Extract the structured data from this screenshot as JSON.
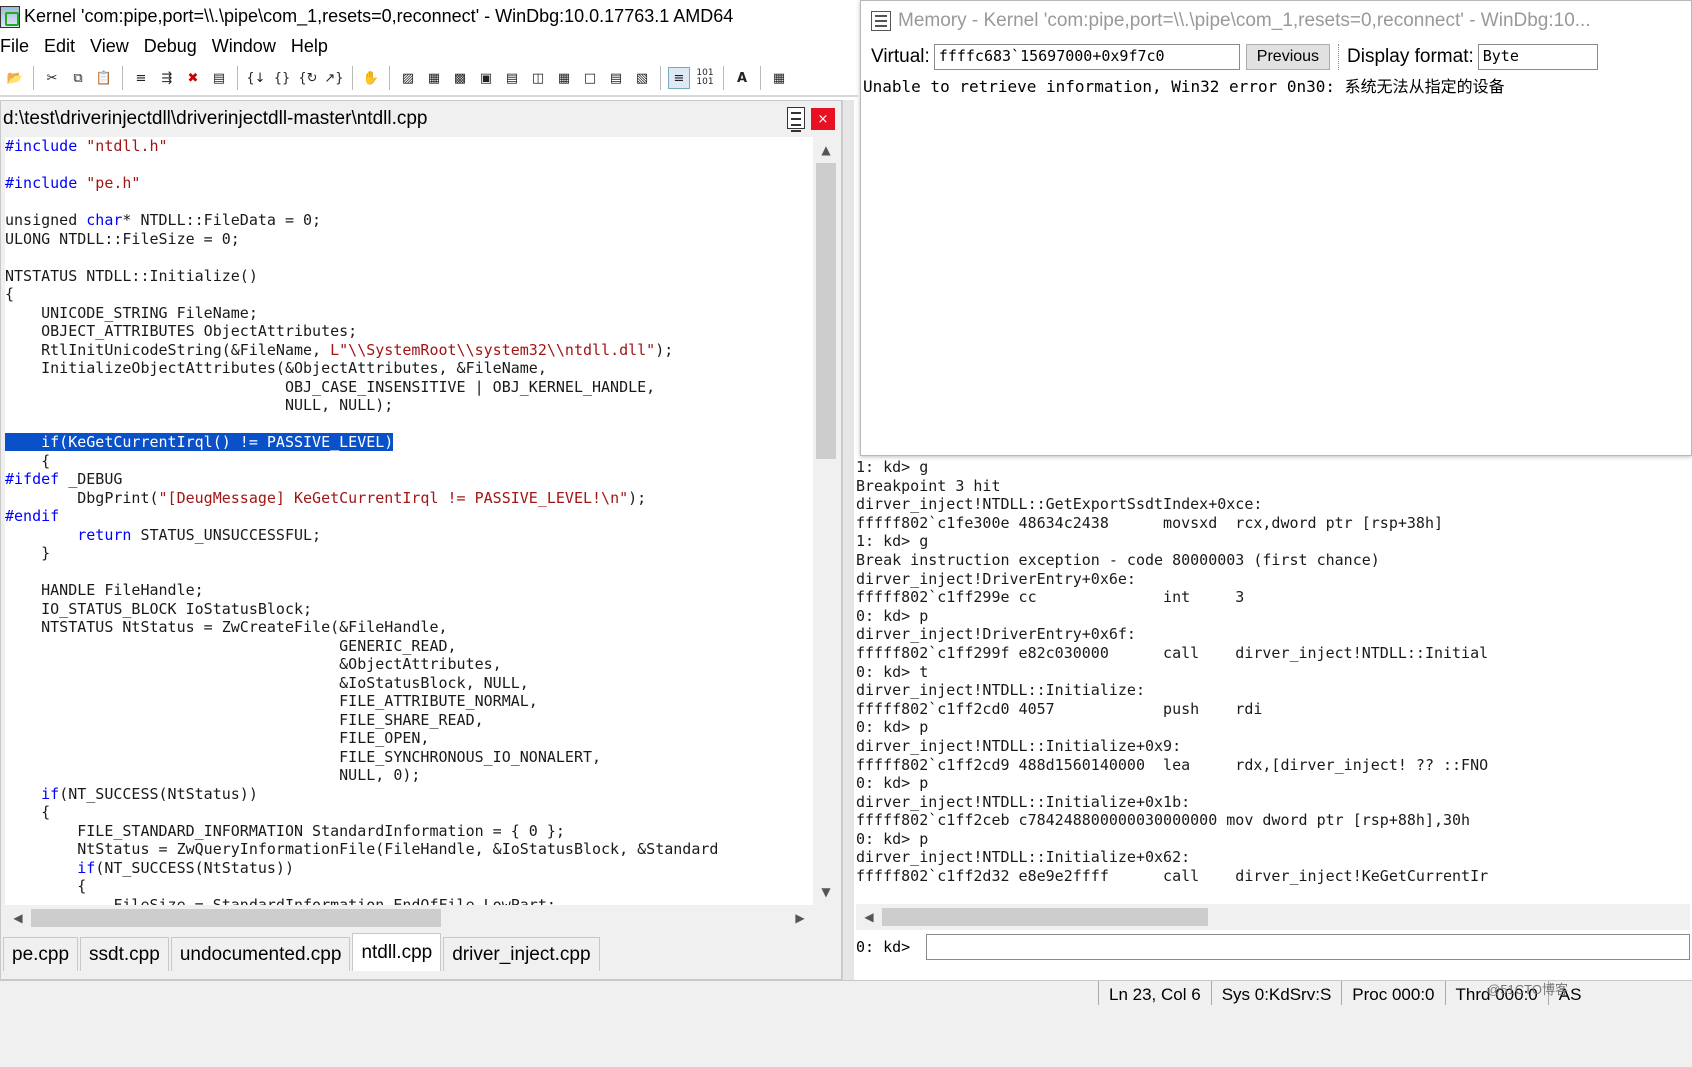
{
  "main_window": {
    "title": "Kernel 'com:pipe,port=\\\\.\\pipe\\com_1,resets=0,reconnect' - WinDbg:10.0.17763.1 AMD64"
  },
  "menu": [
    "File",
    "Edit",
    "View",
    "Debug",
    "Window",
    "Help"
  ],
  "toolbar_icons": [
    "open-icon",
    "cut-icon",
    "copy-icon",
    "paste-icon",
    "step-into-source-icon",
    "step-over-source-icon",
    "breakpoint-icon",
    "run-to-cursor-icon",
    "go-icon",
    "step-into-icon",
    "step-over-icon",
    "step-out-icon",
    "break-icon",
    "command-window-icon",
    "watch-icon",
    "locals-icon",
    "registers-icon",
    "memory-icon",
    "call-stack-icon",
    "disassembly-icon",
    "scratch-pad-icon",
    "processes-icon",
    "source-mode-icon",
    "hex-mode-icon",
    "font-icon",
    "options-icon"
  ],
  "source_window": {
    "path": "d:\\test\\driverinjectdll\\driverinjectdll-master\\ntdll.cpp",
    "close_label": "×",
    "code_lines": [
      [
        {
          "t": "#include",
          "c": "pp"
        },
        {
          "t": " "
        },
        {
          "t": "\"ntdll.h\"",
          "c": "str"
        }
      ],
      [],
      [
        {
          "t": "#include",
          "c": "pp"
        },
        {
          "t": " "
        },
        {
          "t": "\"pe.h\"",
          "c": "str"
        }
      ],
      [],
      [
        {
          "t": "unsigned "
        },
        {
          "t": "char",
          "c": "kw"
        },
        {
          "t": "* NTDLL::FileData = 0;"
        }
      ],
      [
        {
          "t": "ULONG NTDLL::FileSize = 0;"
        }
      ],
      [],
      [
        {
          "t": "NTSTATUS NTDLL::Initialize()"
        }
      ],
      [
        {
          "t": "{"
        }
      ],
      [
        {
          "t": "    UNICODE_STRING FileName;"
        }
      ],
      [
        {
          "t": "    OBJECT_ATTRIBUTES ObjectAttributes;"
        }
      ],
      [
        {
          "t": "    RtlInitUnicodeString(&FileName, "
        },
        {
          "t": "L\"\\\\SystemRoot\\\\system32\\\\ntdll.dll\"",
          "c": "str"
        },
        {
          "t": ");"
        }
      ],
      [
        {
          "t": "    InitializeObjectAttributes(&ObjectAttributes, &FileName,"
        }
      ],
      [
        {
          "t": "                               OBJ_CASE_INSENSITIVE | OBJ_KERNEL_HANDLE,"
        }
      ],
      [
        {
          "t": "                               NULL, NULL);"
        }
      ],
      [],
      [
        {
          "t": "    if(KeGetCurrentIrql() != PASSIVE_LEVEL)",
          "c": "hl"
        }
      ],
      [
        {
          "t": "    {"
        }
      ],
      [
        {
          "t": "#ifdef",
          "c": "pp"
        },
        {
          "t": " _DEBUG"
        }
      ],
      [
        {
          "t": "        DbgPrint("
        },
        {
          "t": "\"[DeugMessage] KeGetCurrentIrql != PASSIVE_LEVEL!\\n\"",
          "c": "str"
        },
        {
          "t": ");"
        }
      ],
      [
        {
          "t": "#endif",
          "c": "pp"
        }
      ],
      [
        {
          "t": "        "
        },
        {
          "t": "return",
          "c": "kw"
        },
        {
          "t": " STATUS_UNSUCCESSFUL;"
        }
      ],
      [
        {
          "t": "    }"
        }
      ],
      [],
      [
        {
          "t": "    HANDLE FileHandle;"
        }
      ],
      [
        {
          "t": "    IO_STATUS_BLOCK IoStatusBlock;"
        }
      ],
      [
        {
          "t": "    NTSTATUS NtStatus = ZwCreateFile(&FileHandle,"
        }
      ],
      [
        {
          "t": "                                     GENERIC_READ,"
        }
      ],
      [
        {
          "t": "                                     &ObjectAttributes,"
        }
      ],
      [
        {
          "t": "                                     &IoStatusBlock, NULL,"
        }
      ],
      [
        {
          "t": "                                     FILE_ATTRIBUTE_NORMAL,"
        }
      ],
      [
        {
          "t": "                                     FILE_SHARE_READ,"
        }
      ],
      [
        {
          "t": "                                     FILE_OPEN,"
        }
      ],
      [
        {
          "t": "                                     FILE_SYNCHRONOUS_IO_NONALERT,"
        }
      ],
      [
        {
          "t": "                                     NULL, 0);"
        }
      ],
      [
        {
          "t": "    "
        },
        {
          "t": "if",
          "c": "kw"
        },
        {
          "t": "(NT_SUCCESS(NtStatus))"
        }
      ],
      [
        {
          "t": "    {"
        }
      ],
      [
        {
          "t": "        FILE_STANDARD_INFORMATION StandardInformation = { 0 };"
        }
      ],
      [
        {
          "t": "        NtStatus = ZwQueryInformationFile(FileHandle, &IoStatusBlock, &Standard"
        }
      ],
      [
        {
          "t": "        "
        },
        {
          "t": "if",
          "c": "kw"
        },
        {
          "t": "(NT_SUCCESS(NtStatus))"
        }
      ],
      [
        {
          "t": "        {"
        }
      ],
      [
        {
          "t": "            FileSize = StandardInformation.EndOfFile.LowPart;"
        }
      ]
    ],
    "tabs": [
      {
        "label": "pe.cpp",
        "active": false
      },
      {
        "label": "ssdt.cpp",
        "active": false
      },
      {
        "label": "undocumented.cpp",
        "active": false
      },
      {
        "label": "ntdll.cpp",
        "active": true
      },
      {
        "label": "driver_inject.cpp",
        "active": false
      }
    ]
  },
  "memory_window": {
    "title": "Memory - Kernel 'com:pipe,port=\\\\.\\pipe\\com_1,resets=0,reconnect' - WinDbg:10...",
    "virtual_label": "Virtual:",
    "virtual_value": "ffffc683`15697000+0x9f7c0",
    "previous_label": "Previous",
    "display_format_label": "Display format:",
    "display_format_value": "Byte",
    "content": "Unable to retrieve information, Win32 error 0n30: 系统无法从指定的设备"
  },
  "command_window": {
    "lines": [
      "1: kd> g",
      "Breakpoint 3 hit",
      "dirver_inject!NTDLL::GetExportSsdtIndex+0xce:",
      "fffff802`c1fe300e 48634c2438      movsxd  rcx,dword ptr [rsp+38h]",
      "1: kd> g",
      "Break instruction exception - code 80000003 (first chance)",
      "dirver_inject!DriverEntry+0x6e:",
      "fffff802`c1ff299e cc              int     3",
      "0: kd> p",
      "dirver_inject!DriverEntry+0x6f:",
      "fffff802`c1ff299f e82c030000      call    dirver_inject!NTDLL::Initial",
      "0: kd> t",
      "dirver_inject!NTDLL::Initialize:",
      "fffff802`c1ff2cd0 4057            push    rdi",
      "0: kd> p",
      "dirver_inject!NTDLL::Initialize+0x9:",
      "fffff802`c1ff2cd9 488d1560140000  lea     rdx,[dirver_inject! ?? ::FNO",
      "0: kd> p",
      "dirver_inject!NTDLL::Initialize+0x1b:",
      "fffff802`c1ff2ceb c784248800000030000000 mov dword ptr [rsp+88h],30h",
      "0: kd> p",
      "dirver_inject!NTDLL::Initialize+0x62:",
      "fffff802`c1ff2d32 e8e9e2ffff      call    dirver_inject!KeGetCurrentIr"
    ],
    "prompt": "0: kd>",
    "input_value": ""
  },
  "status_bar": {
    "fields": [
      "Ln 23, Col 6",
      "Sys 0:KdSrv:S",
      "Proc 000:0",
      "Thrd 000:0",
      "AS"
    ],
    "watermark": "@51CTO博客"
  }
}
